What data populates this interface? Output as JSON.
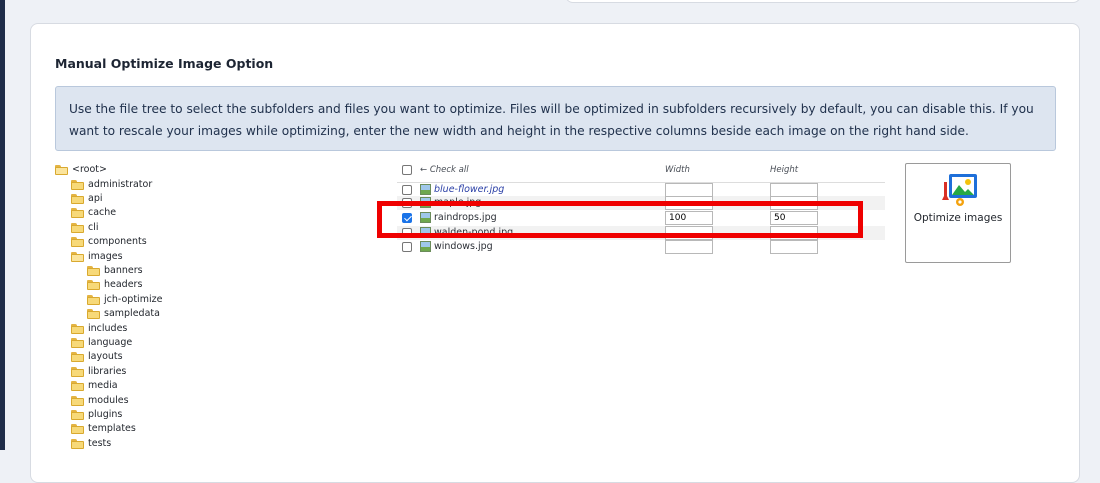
{
  "panel": {
    "title": "Manual Optimize Image Option",
    "info": "Use the file tree to select the subfolders and files you want to optimize. Files will be optimized in subfolders recursively by default, you can disable this. If you want to rescale your images while optimizing, enter the new width and height in the respective columns beside each image on the right hand side."
  },
  "tree": {
    "root": "<root>",
    "folders": [
      "administrator",
      "api",
      "cache",
      "cli",
      "components",
      "images",
      "includes",
      "language",
      "layouts",
      "libraries",
      "media",
      "modules",
      "plugins",
      "templates",
      "tests"
    ],
    "images_children": [
      "banners",
      "headers",
      "jch-optimize",
      "sampledata"
    ]
  },
  "table": {
    "check_all": "← Check all",
    "width_header": "Width",
    "height_header": "Height",
    "files": [
      {
        "name": "blue-flower.jpg",
        "checked": false,
        "width": "",
        "height": ""
      },
      {
        "name": "maple.jpg",
        "checked": false,
        "width": "",
        "height": ""
      },
      {
        "name": "raindrops.jpg",
        "checked": true,
        "width": "100",
        "height": "50"
      },
      {
        "name": "walden-pond.jpg",
        "checked": false,
        "width": "",
        "height": ""
      },
      {
        "name": "windows.jpg",
        "checked": false,
        "width": "",
        "height": ""
      }
    ]
  },
  "optimize_button": {
    "label": "Optimize images",
    "icon": "image-optimize-icon"
  },
  "colors": {
    "highlight": "#ef0000",
    "info_bg": "#dde5f0",
    "rail": "#1f2d49"
  }
}
